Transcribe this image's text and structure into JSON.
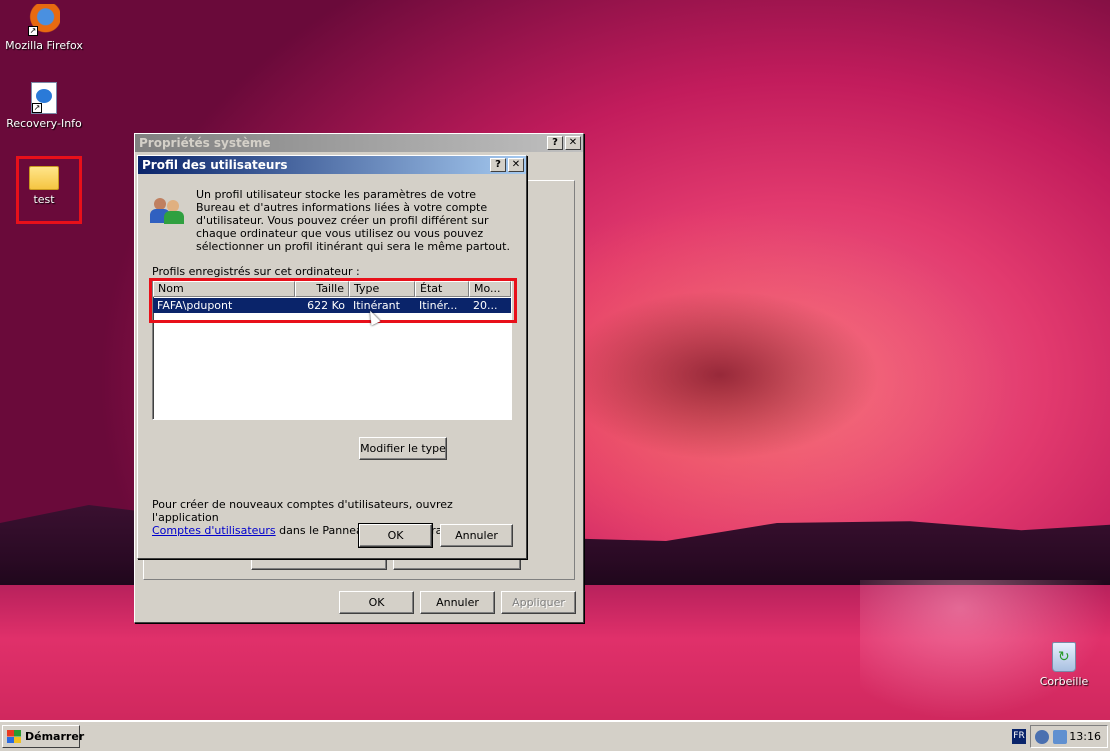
{
  "desktop": {
    "icons": [
      {
        "label": "Mozilla Firefox"
      },
      {
        "label": "Recovery-Info"
      },
      {
        "label": "test"
      },
      {
        "label": "Corbeille"
      }
    ]
  },
  "system_properties": {
    "title": "Propriétés système",
    "help_glyph": "?",
    "close_glyph": "✕",
    "ok_label": "OK",
    "cancel_label": "Annuler",
    "apply_label": "Appliquer"
  },
  "user_profiles": {
    "title": "Profil des utilisateurs",
    "help_glyph": "?",
    "close_glyph": "✕",
    "description": "Un profil utilisateur stocke les paramètres de votre Bureau et d'autres informations liées à votre compte d'utilisateur. Vous pouvez créer un profil différent sur chaque ordinateur que vous utilisez ou vous pouvez sélectionner un profil itinérant qui sera le même partout.",
    "list_label": "Profils enregistrés sur cet ordinateur :",
    "columns": [
      "Nom",
      "Taille",
      "Type",
      "État",
      "Mo..."
    ],
    "rows": [
      {
        "name": "FAFA\\pdupont",
        "size": "622 Ko",
        "type": "Itinérant",
        "state": "Itinér...",
        "modified": "20..."
      }
    ],
    "change_type_label": "Modifier le type",
    "note_prefix": "Pour créer de nouveaux comptes d'utilisateurs, ouvrez l'application",
    "note_link": "Comptes d'utilisateurs",
    "note_suffix": "dans le Panneau de configuration.",
    "ok_label": "OK",
    "cancel_label": "Annuler"
  },
  "taskbar": {
    "start_label": "Démarrer",
    "language": "FR",
    "clock": "13:16"
  },
  "colors": {
    "highlight_red": "#e8101a",
    "title_active": "#0a246a",
    "selection": "#0a246a",
    "link": "#0000cc"
  }
}
